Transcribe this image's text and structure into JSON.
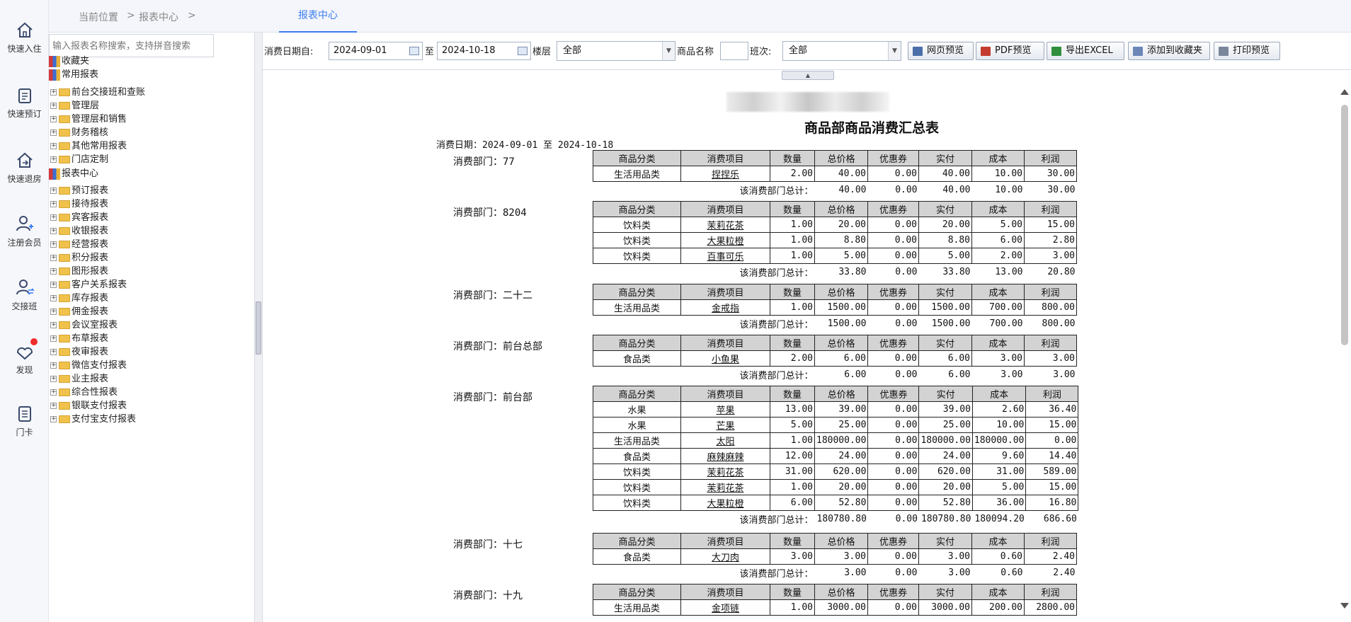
{
  "nav": [
    {
      "label": "快速入住",
      "icon": "home-icon"
    },
    {
      "label": "快速预订",
      "icon": "booking-icon"
    },
    {
      "label": "快速退房",
      "icon": "checkout-icon"
    },
    {
      "label": "注册会员",
      "icon": "add-member-icon"
    },
    {
      "label": "交接班",
      "icon": "shift-handover-icon"
    },
    {
      "label": "发现",
      "icon": "discover-icon"
    },
    {
      "label": "门卡",
      "icon": "door-card-icon"
    }
  ],
  "breadcrumb": {
    "current_location": "当前位置",
    "sep": ">",
    "level1": "报表中心"
  },
  "active_tab": "报表中心",
  "tree": {
    "search_placeholder": "输入报表名称搜索，支持拼音搜索",
    "items": [
      {
        "label": "收藏夹",
        "type": "root"
      },
      {
        "label": "常用报表",
        "type": "root"
      },
      {
        "label": "前台交接班和查账",
        "type": "folder"
      },
      {
        "label": "管理层",
        "type": "folder"
      },
      {
        "label": "管理层和销售",
        "type": "folder"
      },
      {
        "label": "财务稽核",
        "type": "folder"
      },
      {
        "label": "其他常用报表",
        "type": "folder"
      },
      {
        "label": "门店定制",
        "type": "folder"
      },
      {
        "label": "报表中心",
        "type": "root"
      },
      {
        "label": "预订报表",
        "type": "folder"
      },
      {
        "label": "接待报表",
        "type": "folder"
      },
      {
        "label": "宾客报表",
        "type": "folder"
      },
      {
        "label": "收银报表",
        "type": "folder"
      },
      {
        "label": "经营报表",
        "type": "folder"
      },
      {
        "label": "积分报表",
        "type": "folder"
      },
      {
        "label": "图形报表",
        "type": "folder"
      },
      {
        "label": "客户关系报表",
        "type": "folder"
      },
      {
        "label": "库存报表",
        "type": "folder"
      },
      {
        "label": "佣金报表",
        "type": "folder"
      },
      {
        "label": "会议室报表",
        "type": "folder"
      },
      {
        "label": "布草报表",
        "type": "folder"
      },
      {
        "label": "夜审报表",
        "type": "folder"
      },
      {
        "label": "微信支付报表",
        "type": "folder"
      },
      {
        "label": "业主报表",
        "type": "folder"
      },
      {
        "label": "综合性报表",
        "type": "folder"
      },
      {
        "label": "银联支付报表",
        "type": "folder"
      },
      {
        "label": "支付宝支付报表",
        "type": "folder"
      }
    ]
  },
  "toolbar": {
    "date_from_label": "消费日期自:",
    "date_from": "2024-09-01",
    "to_label": "至",
    "date_to": "2024-10-18",
    "floor_label": "楼层",
    "floor_value": "全部",
    "product_name_label": "商品名称",
    "product_name_value": "",
    "shift_label": "班次:",
    "shift_value": "全部",
    "buttons": [
      "网页预览",
      "PDF预览",
      "导出EXCEL",
      "添加到收藏夹",
      "打印预览"
    ]
  },
  "report": {
    "title": "商品部商品消费汇总表",
    "date_line": "消费日期：2024-09-01 至 2024-10-18",
    "headers": [
      "商品分类",
      "消费项目",
      "数量",
      "总价格",
      "优惠券",
      "实付",
      "成本",
      "利润"
    ],
    "subtotal_label": "该消费部门总计：",
    "departments": [
      {
        "dept": "消费部门：77",
        "rows": [
          [
            "生活用品类",
            "捏捏乐",
            "2.00",
            "40.00",
            "0.00",
            "40.00",
            "10.00",
            "30.00"
          ]
        ],
        "total": [
          "40.00",
          "0.00",
          "40.00",
          "10.00",
          "30.00"
        ]
      },
      {
        "dept": "消费部门：8204",
        "rows": [
          [
            "饮料类",
            "茉莉花茶",
            "1.00",
            "20.00",
            "0.00",
            "20.00",
            "5.00",
            "15.00"
          ],
          [
            "饮料类",
            "大果粒橙",
            "1.00",
            "8.80",
            "0.00",
            "8.80",
            "6.00",
            "2.80"
          ],
          [
            "饮料类",
            "百事可乐",
            "1.00",
            "5.00",
            "0.00",
            "5.00",
            "2.00",
            "3.00"
          ]
        ],
        "total": [
          "33.80",
          "0.00",
          "33.80",
          "13.00",
          "20.80"
        ]
      },
      {
        "dept": "消费部门：二十二",
        "rows": [
          [
            "生活用品类",
            "金戒指",
            "1.00",
            "1500.00",
            "0.00",
            "1500.00",
            "700.00",
            "800.00"
          ]
        ],
        "total": [
          "1500.00",
          "0.00",
          "1500.00",
          "700.00",
          "800.00"
        ]
      },
      {
        "dept": "消费部门：前台总部",
        "rows": [
          [
            "食品类",
            "小鱼果",
            "2.00",
            "6.00",
            "0.00",
            "6.00",
            "3.00",
            "3.00"
          ]
        ],
        "total": [
          "6.00",
          "0.00",
          "6.00",
          "3.00",
          "3.00"
        ]
      },
      {
        "dept": "消费部门：前台部",
        "rows": [
          [
            "水果",
            "苹果",
            "13.00",
            "39.00",
            "0.00",
            "39.00",
            "2.60",
            "36.40"
          ],
          [
            "水果",
            "芒果",
            "5.00",
            "25.00",
            "0.00",
            "25.00",
            "10.00",
            "15.00"
          ],
          [
            "生活用品类",
            "太阳",
            "1.00",
            "180000.00",
            "0.00",
            "180000.00",
            "180000.00",
            "0.00"
          ],
          [
            "食品类",
            "麻辣麻辣",
            "12.00",
            "24.00",
            "0.00",
            "24.00",
            "9.60",
            "14.40"
          ],
          [
            "饮料类",
            "茉莉花茶",
            "31.00",
            "620.00",
            "0.00",
            "620.00",
            "31.00",
            "589.00"
          ],
          [
            "饮料类",
            "茉莉花茶",
            "1.00",
            "20.00",
            "0.00",
            "20.00",
            "5.00",
            "15.00"
          ],
          [
            "饮料类",
            "大果粒橙",
            "6.00",
            "52.80",
            "0.00",
            "52.80",
            "36.00",
            "16.80"
          ]
        ],
        "total": [
          "180780.80",
          "0.00",
          "180780.80",
          "180094.20",
          "686.60"
        ]
      },
      {
        "dept": "消费部门：十七",
        "rows": [
          [
            "食品类",
            "大刀肉",
            "3.00",
            "3.00",
            "0.00",
            "3.00",
            "0.60",
            "2.40"
          ]
        ],
        "total": [
          "3.00",
          "0.00",
          "3.00",
          "0.60",
          "2.40"
        ]
      },
      {
        "dept": "消费部门：十九",
        "rows": [
          [
            "生活用品类",
            "金项链",
            "1.00",
            "3000.00",
            "0.00",
            "3000.00",
            "200.00",
            "2800.00"
          ]
        ],
        "total": null
      }
    ]
  }
}
